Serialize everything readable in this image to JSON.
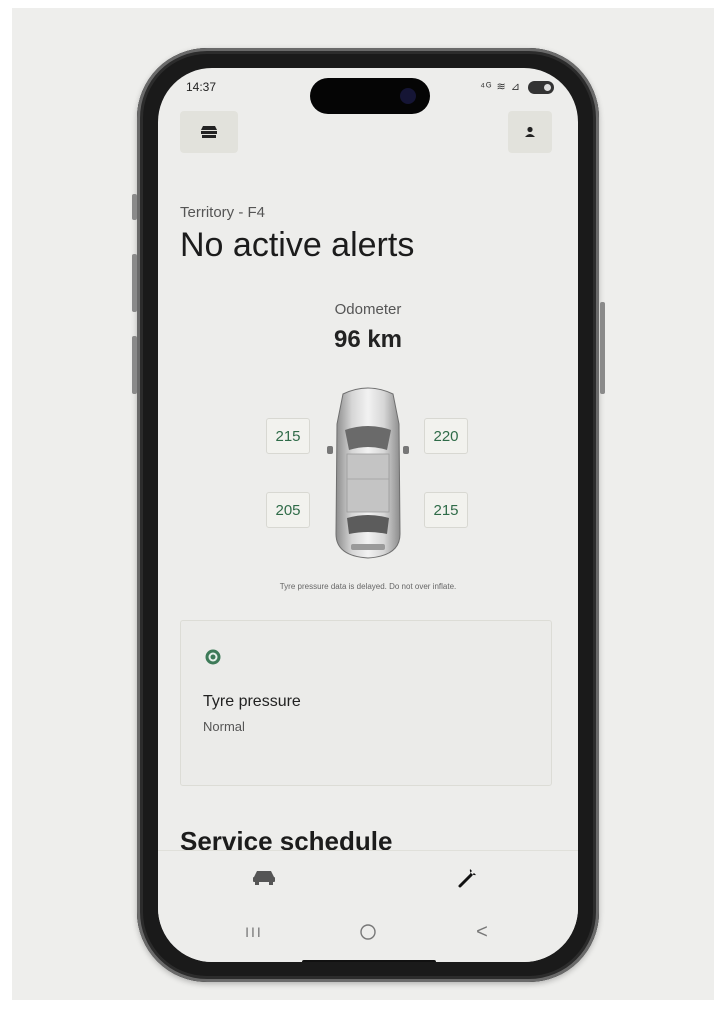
{
  "status_bar": {
    "time": "14:37",
    "icons": "⁴ᴳ ≋ ⊿"
  },
  "header": {
    "menu_icon": "car-menu-icon",
    "profile_icon": "person-icon"
  },
  "vehicle": {
    "name": "Territory - F4",
    "headline": "No active alerts"
  },
  "odometer": {
    "label": "Odometer",
    "value": "96 km"
  },
  "tyres": {
    "front_left": "215",
    "front_right": "220",
    "rear_left": "205",
    "rear_right": "215"
  },
  "note": "Tyre pressure data is delayed. Do not over inflate.",
  "status_card": {
    "icon": "ok-status-icon",
    "title": "Tyre pressure",
    "status": "Normal",
    "status_color": "#3d7a58"
  },
  "section": {
    "title": "Service schedule"
  },
  "bottom_nav": {
    "items": [
      {
        "icon": "car-icon"
      },
      {
        "icon": "wrench-icon"
      }
    ]
  },
  "system_nav": {
    "recent": "III",
    "back": "<"
  }
}
